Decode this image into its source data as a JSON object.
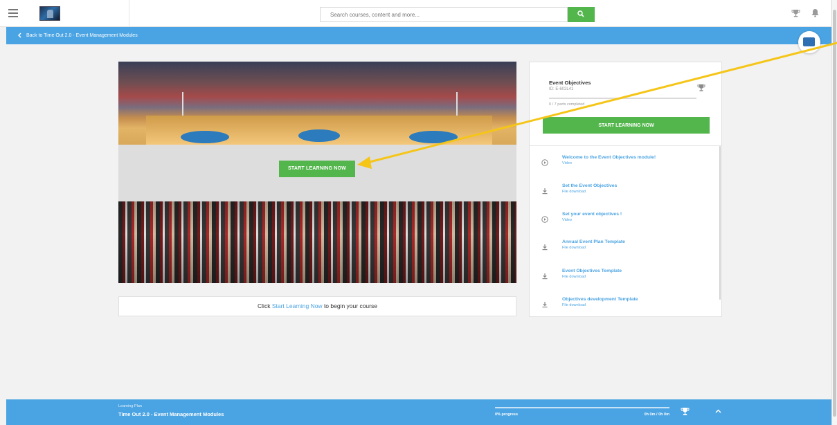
{
  "header": {
    "search_placeholder": "Search courses, content and more...",
    "icons": [
      "menu-icon",
      "search-icon",
      "trophy-icon",
      "bell-icon"
    ]
  },
  "backbar": {
    "label": "Back to Time Out 2.0 - Event Management Modules"
  },
  "hero": {
    "start_label": "START LEARNING NOW"
  },
  "cta": {
    "prefix": "Click ",
    "link": "Start Learning Now",
    "suffix": " to begin your course"
  },
  "course": {
    "title": "Event Objectives",
    "id": "ID: E-602L41",
    "parts_completed": "0 / 7 parts completed",
    "progress_fraction": 0,
    "start_label": "START LEARNING NOW",
    "items": [
      {
        "title": "Welcome to the Event Objectives module!",
        "type": "Video",
        "icon": "play-circle-icon"
      },
      {
        "title": "Set the Event Objectives",
        "type": "File download",
        "icon": "download-icon"
      },
      {
        "title": "Set your event objectives !",
        "type": "Video",
        "icon": "play-circle-icon"
      },
      {
        "title": "Annual Event Plan Template",
        "type": "File download",
        "icon": "download-icon"
      },
      {
        "title": "Event Objectives Template",
        "type": "File download",
        "icon": "download-icon"
      },
      {
        "title": "Objectives development Template",
        "type": "File download",
        "icon": "download-icon"
      }
    ]
  },
  "footer": {
    "label": "Learning Plan",
    "title": "Time Out 2.0 - Event Management Modules",
    "progress_text": "0% progress",
    "progress_fraction": 0,
    "time": "0h 0m / 0h 0m"
  },
  "colors": {
    "accent_blue": "#4aa3e2",
    "action_green": "#53b64c",
    "annotation_arrow": "#f5c518"
  }
}
